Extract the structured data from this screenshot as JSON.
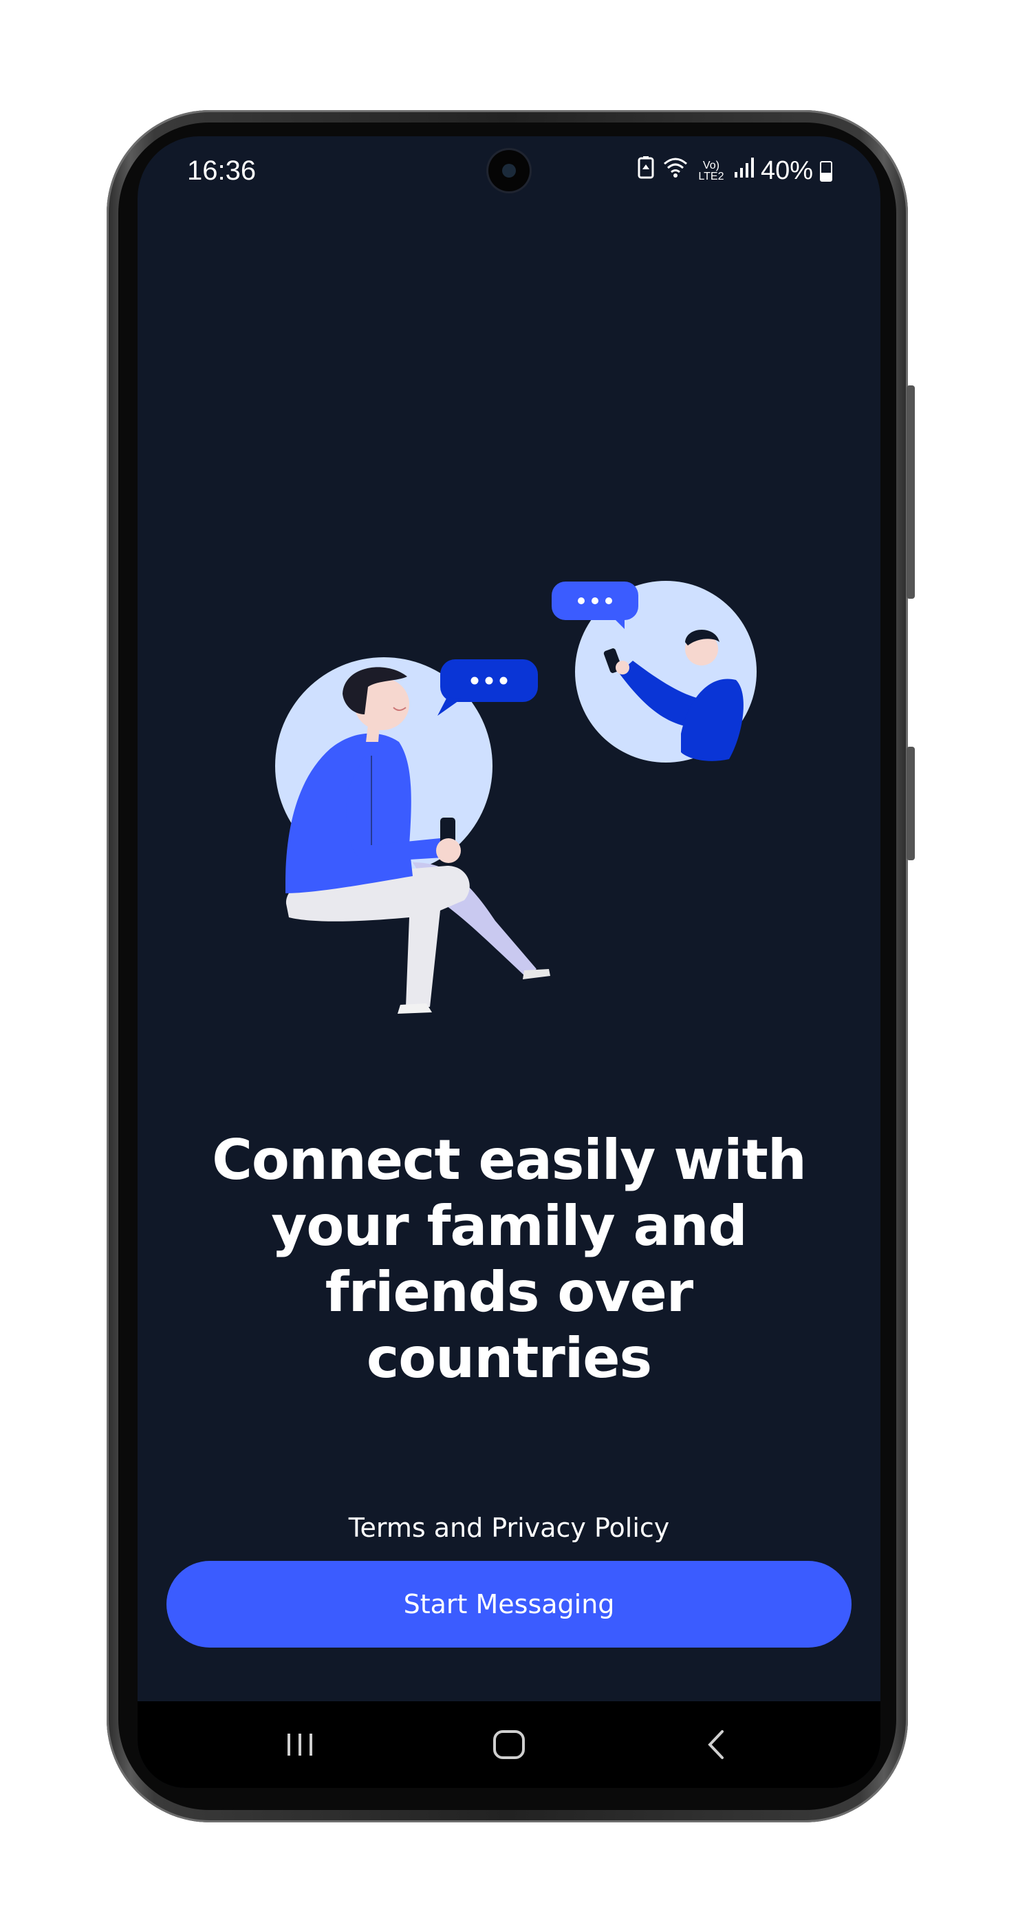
{
  "status_bar": {
    "time": "16:36",
    "icons": [
      "battery-saver-icon",
      "wifi-icon",
      "volte-lte2-icon",
      "signal-icon"
    ],
    "volte_label": "Vo) LTE2",
    "battery_percent": "40%"
  },
  "onboarding": {
    "headline": "Connect easily with your family and friends over countries",
    "terms_link": "Terms and Privacy Policy",
    "start_button": "Start Messaging"
  },
  "nav_bar": {
    "icons": [
      "recent-apps-icon",
      "home-icon",
      "back-icon"
    ]
  },
  "colors": {
    "background": "#101828",
    "accent": "#3b5cff",
    "illustration_circle": "#cfe0ff",
    "illustration_blue": "#3b5cff",
    "illustration_dark_blue": "#0a35d6"
  }
}
